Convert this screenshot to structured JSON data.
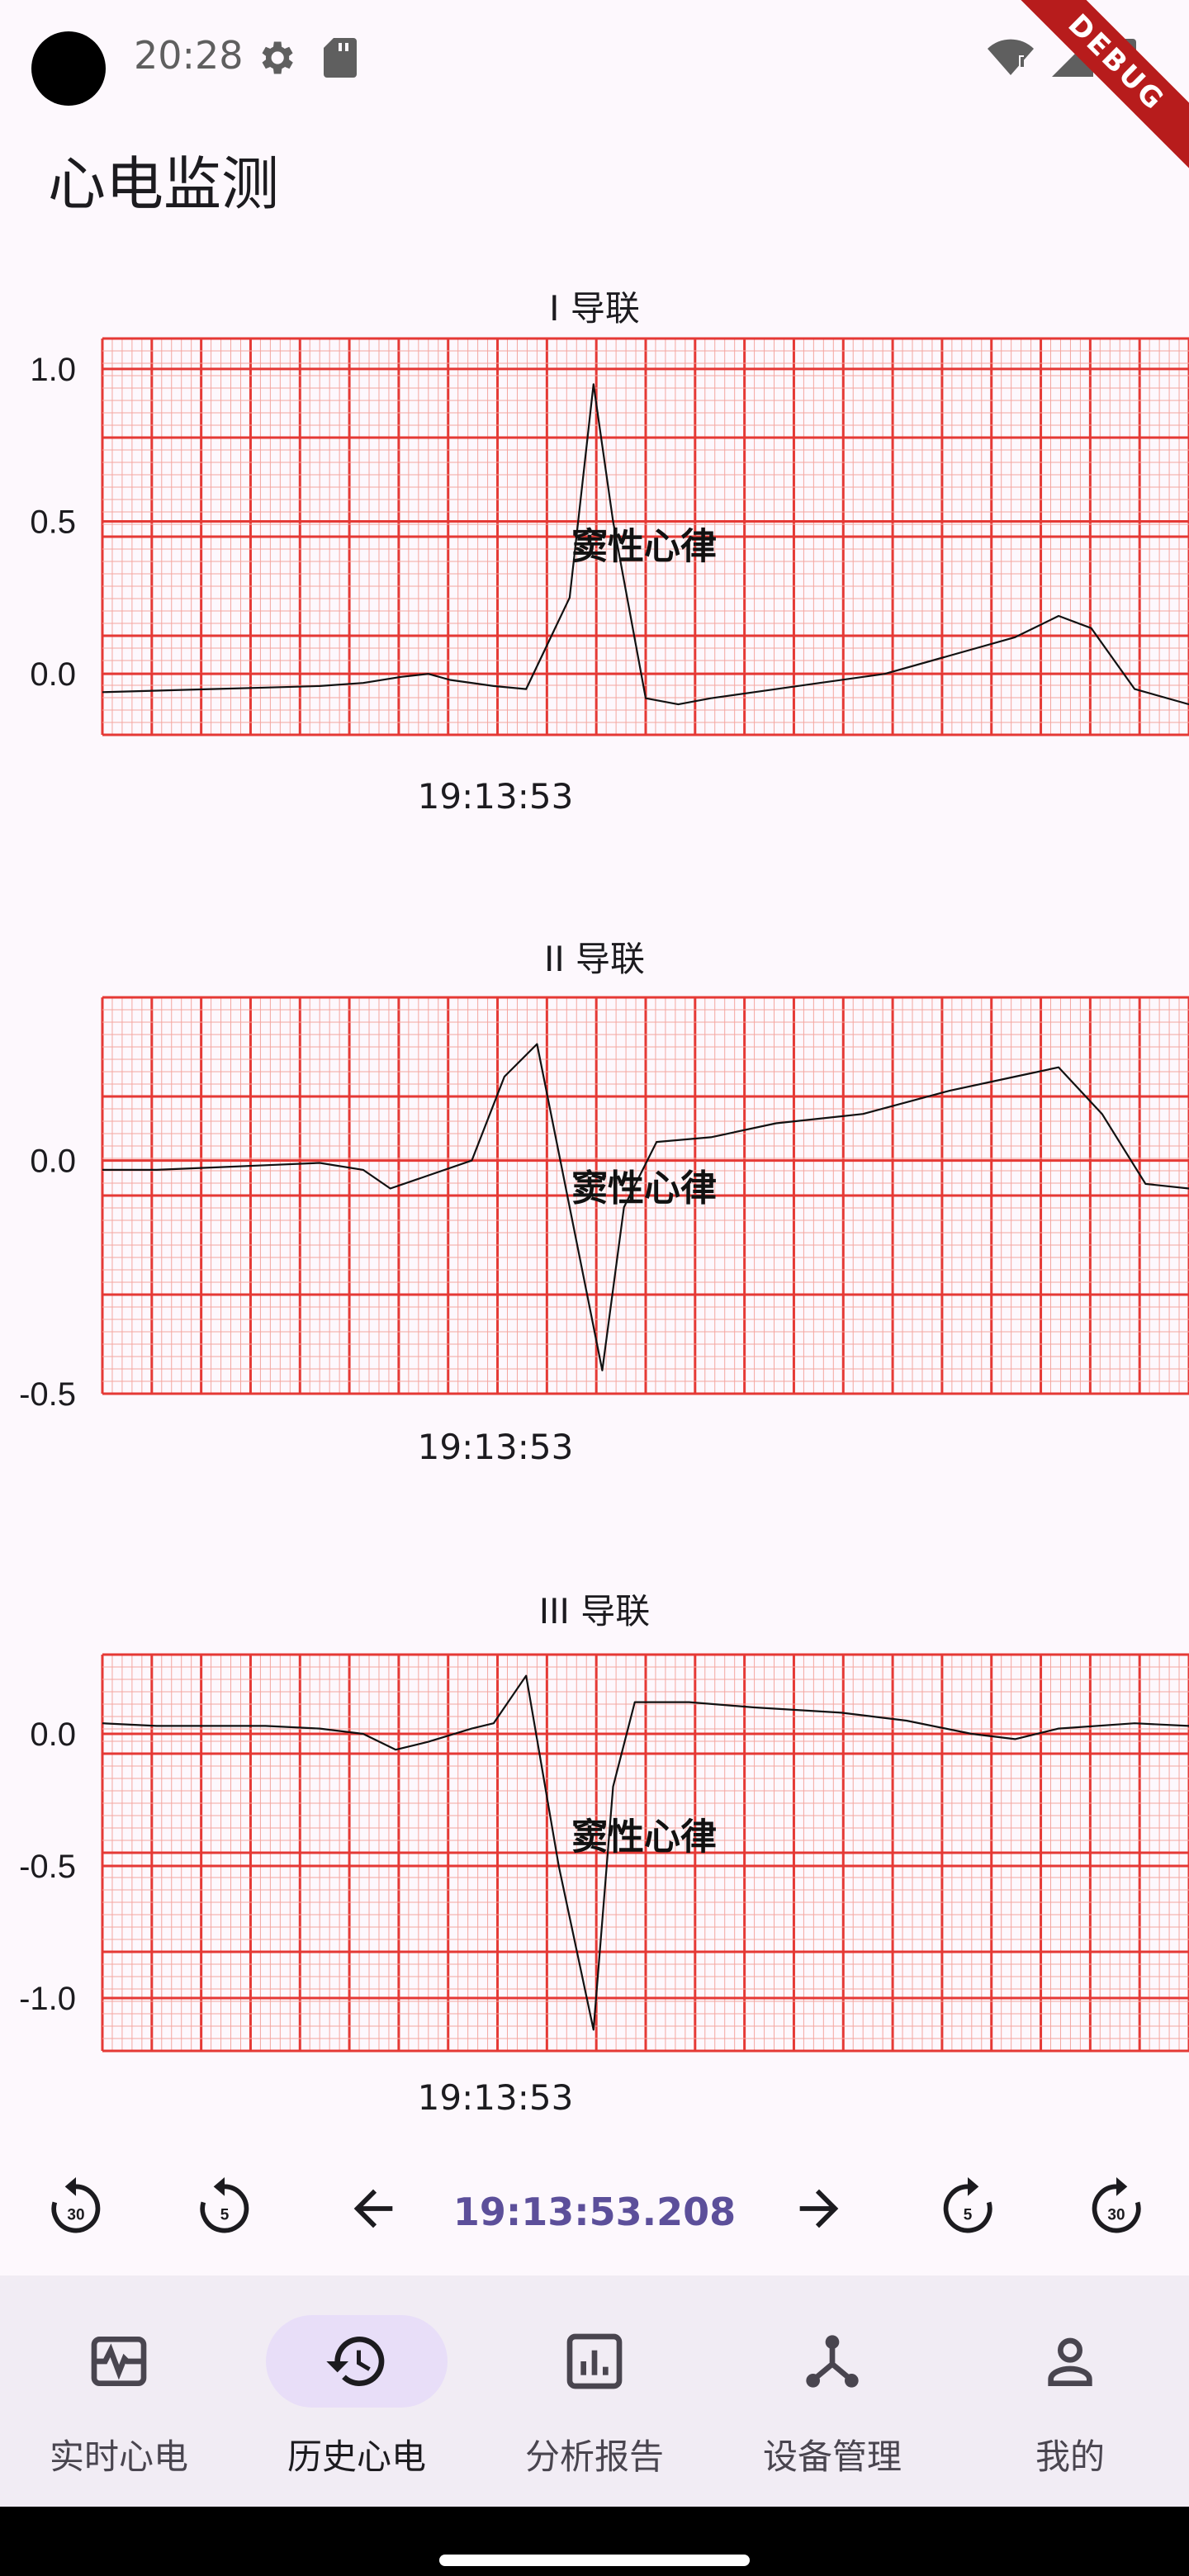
{
  "status_bar": {
    "time": "20:28",
    "debug_label": "DEBUG"
  },
  "page_title": "心电监测",
  "leads": [
    {
      "title": "I 导联",
      "y_ticks": [
        {
          "value": 1.0,
          "label": "1.0"
        },
        {
          "value": 0.5,
          "label": "0.5"
        },
        {
          "value": 0.0,
          "label": "0.0"
        }
      ],
      "ylim": [
        -0.2,
        1.1
      ],
      "annotation": "窦性心律",
      "time_label": "19:13:53"
    },
    {
      "title": "II 导联",
      "y_ticks": [
        {
          "value": 0.0,
          "label": "0.0"
        },
        {
          "value": -0.5,
          "label": "-0.5"
        }
      ],
      "ylim": [
        -0.5,
        0.35
      ],
      "annotation": "窦性心律",
      "time_label": "19:13:53"
    },
    {
      "title": "III 导联",
      "y_ticks": [
        {
          "value": 0.0,
          "label": "0.0"
        },
        {
          "value": -0.5,
          "label": "-0.5"
        },
        {
          "value": -1.0,
          "label": "-1.0"
        }
      ],
      "ylim": [
        -1.2,
        0.3
      ],
      "annotation": "窦性心律",
      "time_label": "19:13:53"
    }
  ],
  "playback": {
    "current_time": "19:13:53.208",
    "rewind_30_label": "30",
    "rewind_5_label": "5",
    "forward_5_label": "5",
    "forward_30_label": "30"
  },
  "nav": [
    {
      "label": "实时心电",
      "icon": "realtime-ecg-icon",
      "active": false
    },
    {
      "label": "历史心电",
      "icon": "history-icon",
      "active": true
    },
    {
      "label": "分析报告",
      "icon": "report-icon",
      "active": false
    },
    {
      "label": "设备管理",
      "icon": "device-icon",
      "active": false
    },
    {
      "label": "我的",
      "icon": "person-icon",
      "active": false
    }
  ],
  "colors": {
    "grid_major": "#e53935",
    "grid_minor": "#f4a6a0",
    "trace": "#111111",
    "accent": "#5c4f9a",
    "nav_active": "#e8def8"
  }
}
